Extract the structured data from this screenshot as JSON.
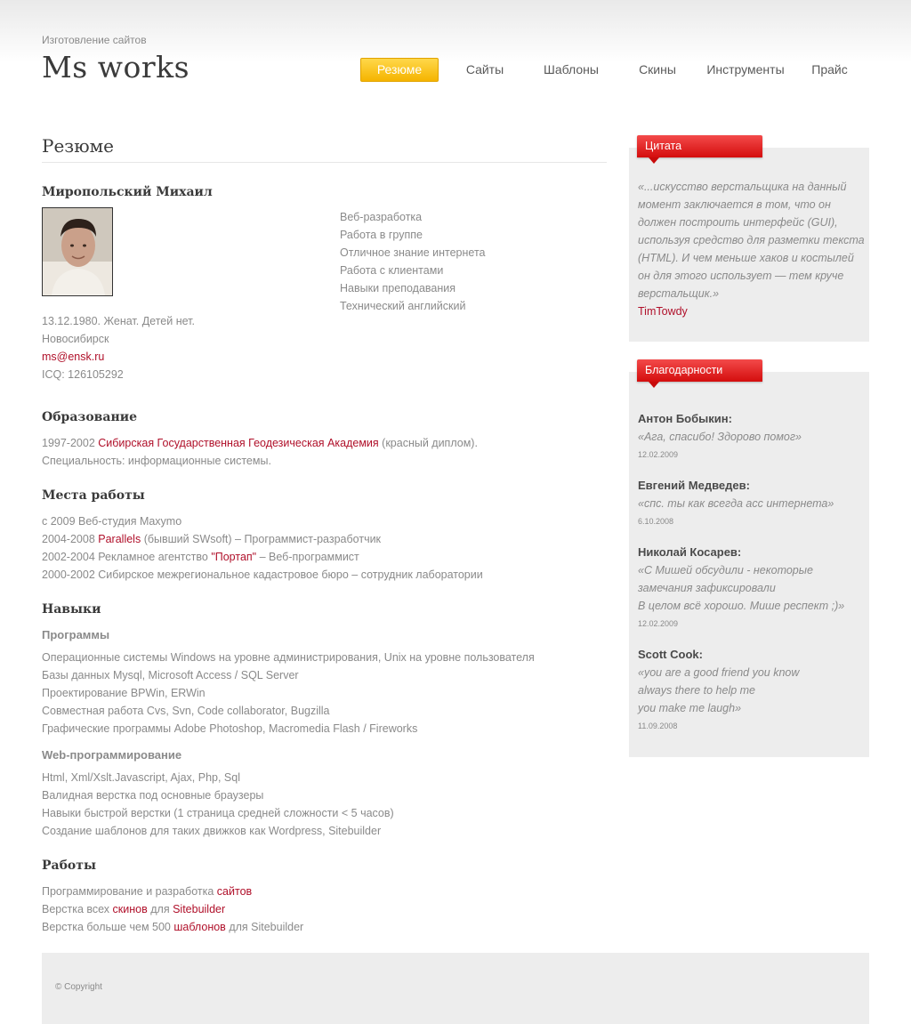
{
  "header": {
    "tagline": "Изготовление сайтов",
    "logo": "Ms works"
  },
  "nav": [
    {
      "label": "Резюме",
      "active": true
    },
    {
      "label": "Сайты",
      "active": false
    },
    {
      "label": "Шаблоны",
      "active": false
    },
    {
      "label": "Скины",
      "active": false
    },
    {
      "label": "Инструменты",
      "active": false
    },
    {
      "label": "Прайс",
      "active": false
    }
  ],
  "main": {
    "title": "Резюме",
    "person": {
      "name": "Миропольский Михаил",
      "personal": {
        "birth": "13.12.1980. Женат. Детей нет.",
        "city": "Новосибирск",
        "email": "ms@ensk.ru",
        "icq": "ICQ: 126105292"
      },
      "skills": [
        "Веб-разработка",
        "Работа в группе",
        "Отличное знание интернета",
        "Работа с клиентами",
        "Навыки преподавания",
        "Технический английский"
      ]
    },
    "education": {
      "heading": "Образование",
      "years": "1997-2002",
      "academy": "Сибирская Государственная Геодезическая Академия",
      "diploma": "(красный диплом).",
      "specialty": "Специальность: информационные системы."
    },
    "work": {
      "heading": "Места работы",
      "line1": "с 2009 Веб-студия Maxymo",
      "line2_years": "2004-2008",
      "line2_company": "Parallels",
      "line2_rest": "(бывший SWsoft) – Программист-разработчик",
      "line3_start": "2002-2004 Рекламное агентство",
      "line3_company": "\"Портап\"",
      "line3_rest": "– Веб-программист",
      "line4": "2000-2002 Сибирское межрегиональное кадастровое бюро – сотрудник лаборатории"
    },
    "skills_section": {
      "heading": "Навыки",
      "programs_heading": "Программы",
      "programs": [
        "Операционные системы Windows на уровне администрирования, Unix на уровне пользователя",
        "Базы данных Mysql, Microsoft Access / SQL Server",
        "Проектирование BPWin, ERWin",
        "Совместная работа Cvs, Svn, Code collaborator, Bugzilla",
        "Графические программы Adobe Photoshop, Macromedia Flash / Fireworks"
      ],
      "web_heading": "Web-программирование",
      "web": [
        "Html, Xml/Xslt.Javascript, Ajax, Php, Sql",
        "Валидная верстка под основные браузеры",
        "Навыки быстрой верстки (1 страница средней сложности < 5 часов)",
        "Создание шаблонов для таких движков как Wordpress, Sitebuilder"
      ]
    },
    "works": {
      "heading": "Работы",
      "l1_text": "Программирование и разработка",
      "l1_link": "сайтов",
      "l2_text1": "Верстка всех",
      "l2_link1": "скинов",
      "l2_text2": "для",
      "l2_link2": "Sitebuilder",
      "l3_text1": "Верстка больше чем 500",
      "l3_link": "шаблонов",
      "l3_text2": "для Sitebuilder"
    }
  },
  "sidebar": {
    "quote": {
      "title": "Цитата",
      "text": "«...искусство верстальщика на данный момент заключается в том, что он должен построить интерфейс (GUI), используя средство для разметки текста (HTML). И чем меньше хаков и костылей он для этого использует — тем круче верстальщик.»",
      "author": "TimTowdy"
    },
    "thanks": {
      "title": "Благодарности",
      "items": [
        {
          "name": "Антон Бобыкин:",
          "text": "«Ага, спасибо! Здорово помог»",
          "date": "12.02.2009"
        },
        {
          "name": "Евгений Медведев:",
          "text": "«спс. ты как всегда асс интернета»",
          "date": "6.10.2008"
        },
        {
          "name": "Николай Косарев:",
          "text": "«С Мишей обсудили - некоторые\nзамечания зафиксировали\nВ целом всё хорошо. Мише респект ;)»",
          "date": "12.02.2009"
        },
        {
          "name": "Scott Cook:",
          "text": "«you are a good friend you know\nalways there to help me\nyou make me laugh»",
          "date": "11.09.2008"
        }
      ]
    }
  },
  "footer": {
    "copyright": "© Copyright"
  },
  "colors": {
    "accent_red": "#b0102a",
    "nav_active": "#f5b400",
    "ribbon": "#d40d0d",
    "sidebar_bg": "#ededed"
  }
}
